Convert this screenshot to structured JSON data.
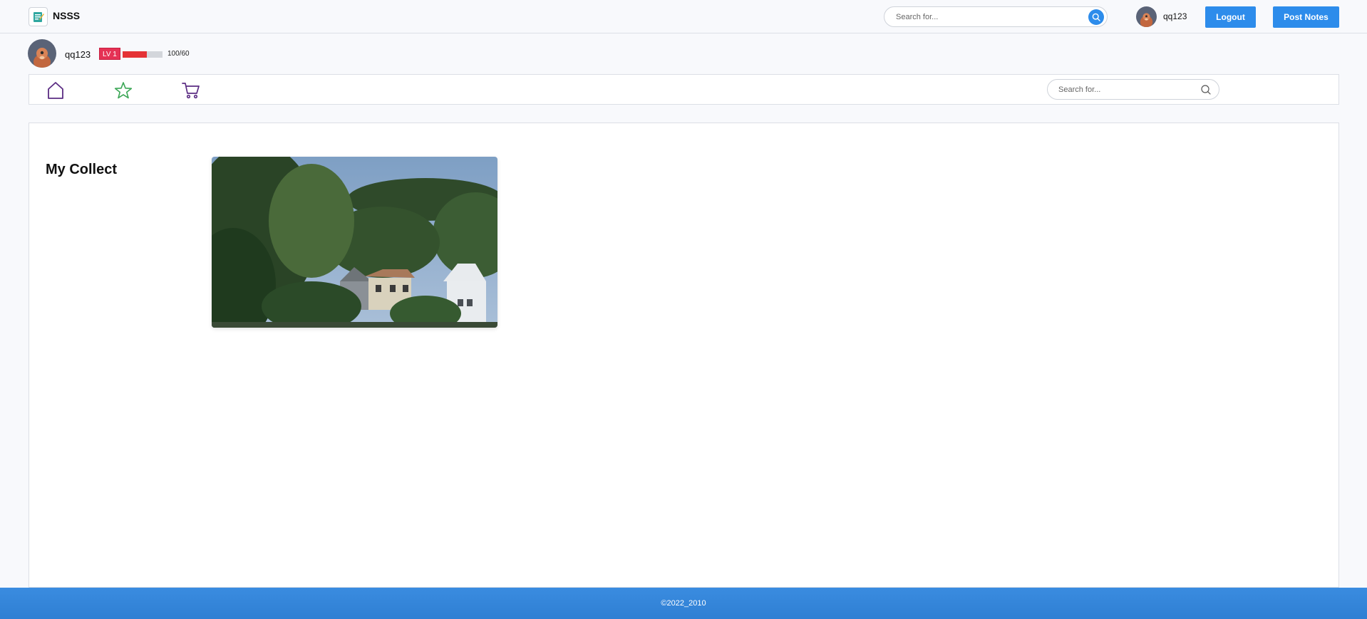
{
  "header": {
    "brand": "NSSS",
    "search_placeholder": "Search for...",
    "username": "qq123",
    "logout_label": "Logout",
    "post_notes_label": "Post Notes"
  },
  "profile": {
    "username": "qq123",
    "level": "LV 1",
    "progress_text": "100/60",
    "progress_fraction": 0.6
  },
  "nav": {
    "icons": [
      "home-icon",
      "star-icon",
      "cart-icon"
    ],
    "search_placeholder": "Search for..."
  },
  "main": {
    "title": "My Collect",
    "items": [
      {
        "image": "houses-trees-photo"
      }
    ]
  },
  "footer": {
    "copyright": "©2022_2010"
  },
  "colors": {
    "accent": "#2d8ceb",
    "level_badge": "#e53255",
    "progress_fill": "#e53235",
    "footer": "#3385db"
  }
}
